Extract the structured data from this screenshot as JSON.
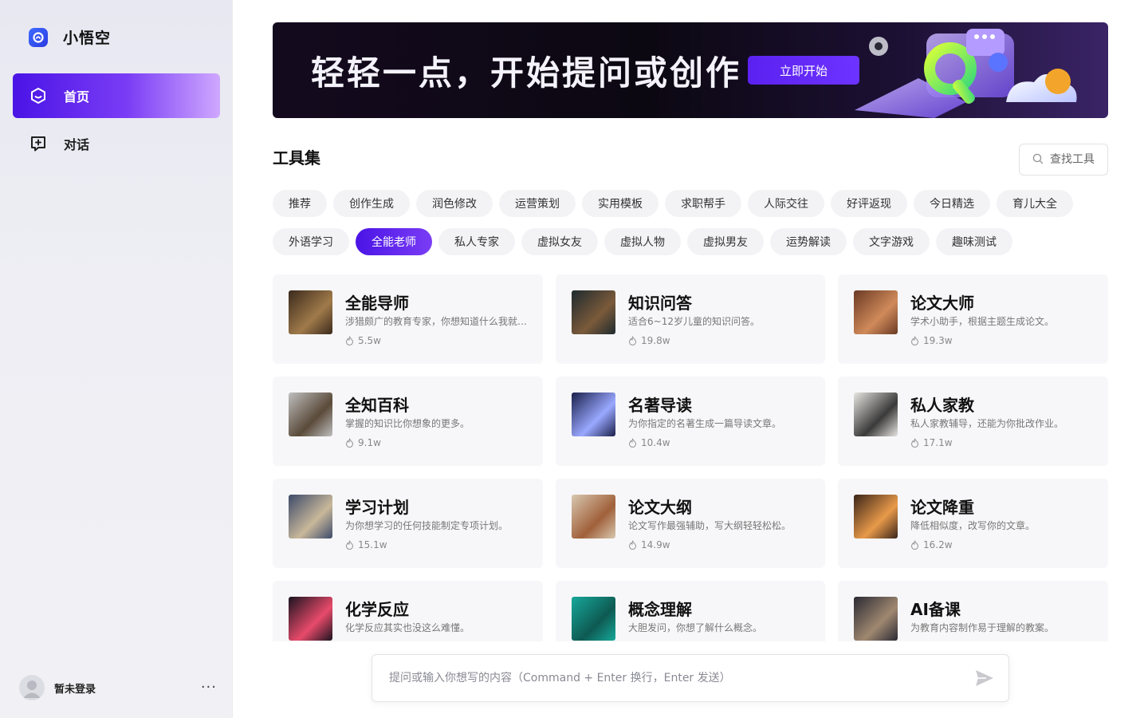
{
  "app": {
    "name": "小悟空"
  },
  "sidebar": {
    "nav": [
      {
        "label": "首页",
        "icon": "home-hexagon-icon",
        "active": true
      },
      {
        "label": "对话",
        "icon": "chat-add-icon",
        "active": false
      }
    ],
    "user": {
      "name": "暂未登录",
      "more": "···"
    }
  },
  "banner": {
    "title": "轻轻一点，开始提问或创作",
    "button": "立即开始"
  },
  "tools": {
    "title": "工具集",
    "search_placeholder": "查找工具",
    "tags_row1": [
      "推荐",
      "创作生成",
      "润色修改",
      "运营策划",
      "实用模板",
      "求职帮手",
      "人际交往",
      "好评返现",
      "今日精选",
      "育儿大全"
    ],
    "tags_row2": [
      "外语学习",
      "全能老师",
      "私人专家",
      "虚拟女友",
      "虚拟人物",
      "虚拟男友",
      "运势解读",
      "文字游戏",
      "趣味测试"
    ],
    "active_tag": "全能老师",
    "cards": [
      {
        "title": "全能导师",
        "desc": "涉猎颇广的教育专家，你想知道什么我就告诉你。",
        "count": "5.5w",
        "thumb": [
          "#3b2a1c",
          "#a07a4a"
        ]
      },
      {
        "title": "知识问答",
        "desc": "适合6~12岁儿童的知识问答。",
        "count": "19.8w",
        "thumb": [
          "#1e2a2f",
          "#7b5a3a"
        ]
      },
      {
        "title": "论文大师",
        "desc": "学术小助手，根据主题生成论文。",
        "count": "19.3w",
        "thumb": [
          "#6a3a24",
          "#d08a5a"
        ]
      },
      {
        "title": "全知百科",
        "desc": "掌握的知识比你想象的更多。",
        "count": "9.1w",
        "thumb": [
          "#bfbfbf",
          "#5a4a3a"
        ]
      },
      {
        "title": "名著导读",
        "desc": "为你指定的名著生成一篇导读文章。",
        "count": "10.4w",
        "thumb": [
          "#1a1f4a",
          "#9aa8ff"
        ]
      },
      {
        "title": "私人家教",
        "desc": "私人家教辅导，还能为你批改作业。",
        "count": "17.1w",
        "thumb": [
          "#e8e6e2",
          "#3a3a3a"
        ]
      },
      {
        "title": "学习计划",
        "desc": "为你想学习的任何技能制定专项计划。",
        "count": "15.1w",
        "thumb": [
          "#3d4a6a",
          "#c8b89a"
        ]
      },
      {
        "title": "论文大纲",
        "desc": "论文写作最强辅助，写大纲轻轻松松。",
        "count": "14.9w",
        "thumb": [
          "#d8c8b0",
          "#a0603a"
        ]
      },
      {
        "title": "论文降重",
        "desc": "降低相似度，改写你的文章。",
        "count": "16.2w",
        "thumb": [
          "#3a2418",
          "#e89a4a"
        ]
      },
      {
        "title": "化学反应",
        "desc": "化学反应其实也没这么难懂。",
        "count": "",
        "thumb": [
          "#1a1420",
          "#e84a6a"
        ]
      },
      {
        "title": "概念理解",
        "desc": "大胆发问，你想了解什么概念。",
        "count": "",
        "thumb": [
          "#17a89a",
          "#0e5a52"
        ]
      },
      {
        "title": "AI备课",
        "desc": "为教育内容制作易于理解的教案。",
        "count": "",
        "thumb": [
          "#2a2a34",
          "#a08870"
        ]
      }
    ]
  },
  "composer": {
    "placeholder": "提问或输入你想写的内容（Command + Enter 换行，Enter 发送）"
  }
}
